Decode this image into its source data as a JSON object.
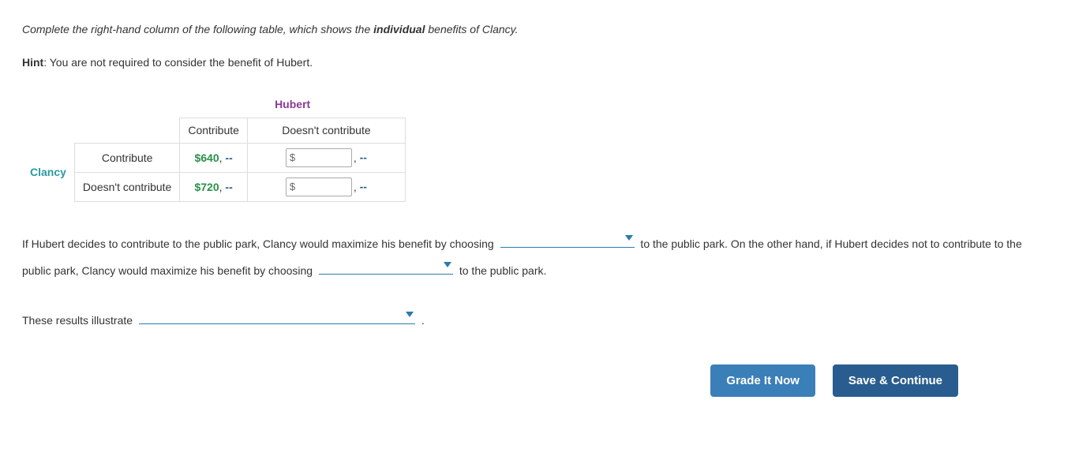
{
  "instruction": {
    "pre": "Complete the right-hand column of the following table, which shows the ",
    "bold": "individual",
    "post": " benefits of Clancy."
  },
  "hint": {
    "label": "Hint",
    "text": ": You are not required to consider the benefit of Hubert."
  },
  "table": {
    "col_player": "Hubert",
    "row_player": "Clancy",
    "col_headers": [
      "Contribute",
      "Doesn't contribute"
    ],
    "row_headers": [
      "Contribute",
      "Doesn't contribute"
    ],
    "cells": {
      "r1c1_value": "$640",
      "r1c1_sep": ", ",
      "r1c1_dash": "--",
      "r1c2_sep": ", ",
      "r1c2_dash": "--",
      "r2c1_value": "$720",
      "r2c1_sep": ", ",
      "r2c1_dash": "--",
      "r2c2_sep": ", ",
      "r2c2_dash": "--"
    },
    "dollar_sign": "$"
  },
  "paragraph": {
    "p1a": "If Hubert decides to contribute to the public park, Clancy would maximize his benefit by choosing ",
    "p1b": " to the public park. On the other hand, if Hubert decides not to contribute to the public park, Clancy would maximize his benefit by choosing ",
    "p1c": " to the public park.",
    "p2a": "These results illustrate ",
    "p2b": " ."
  },
  "buttons": {
    "grade": "Grade It Now",
    "save": "Save & Continue"
  }
}
